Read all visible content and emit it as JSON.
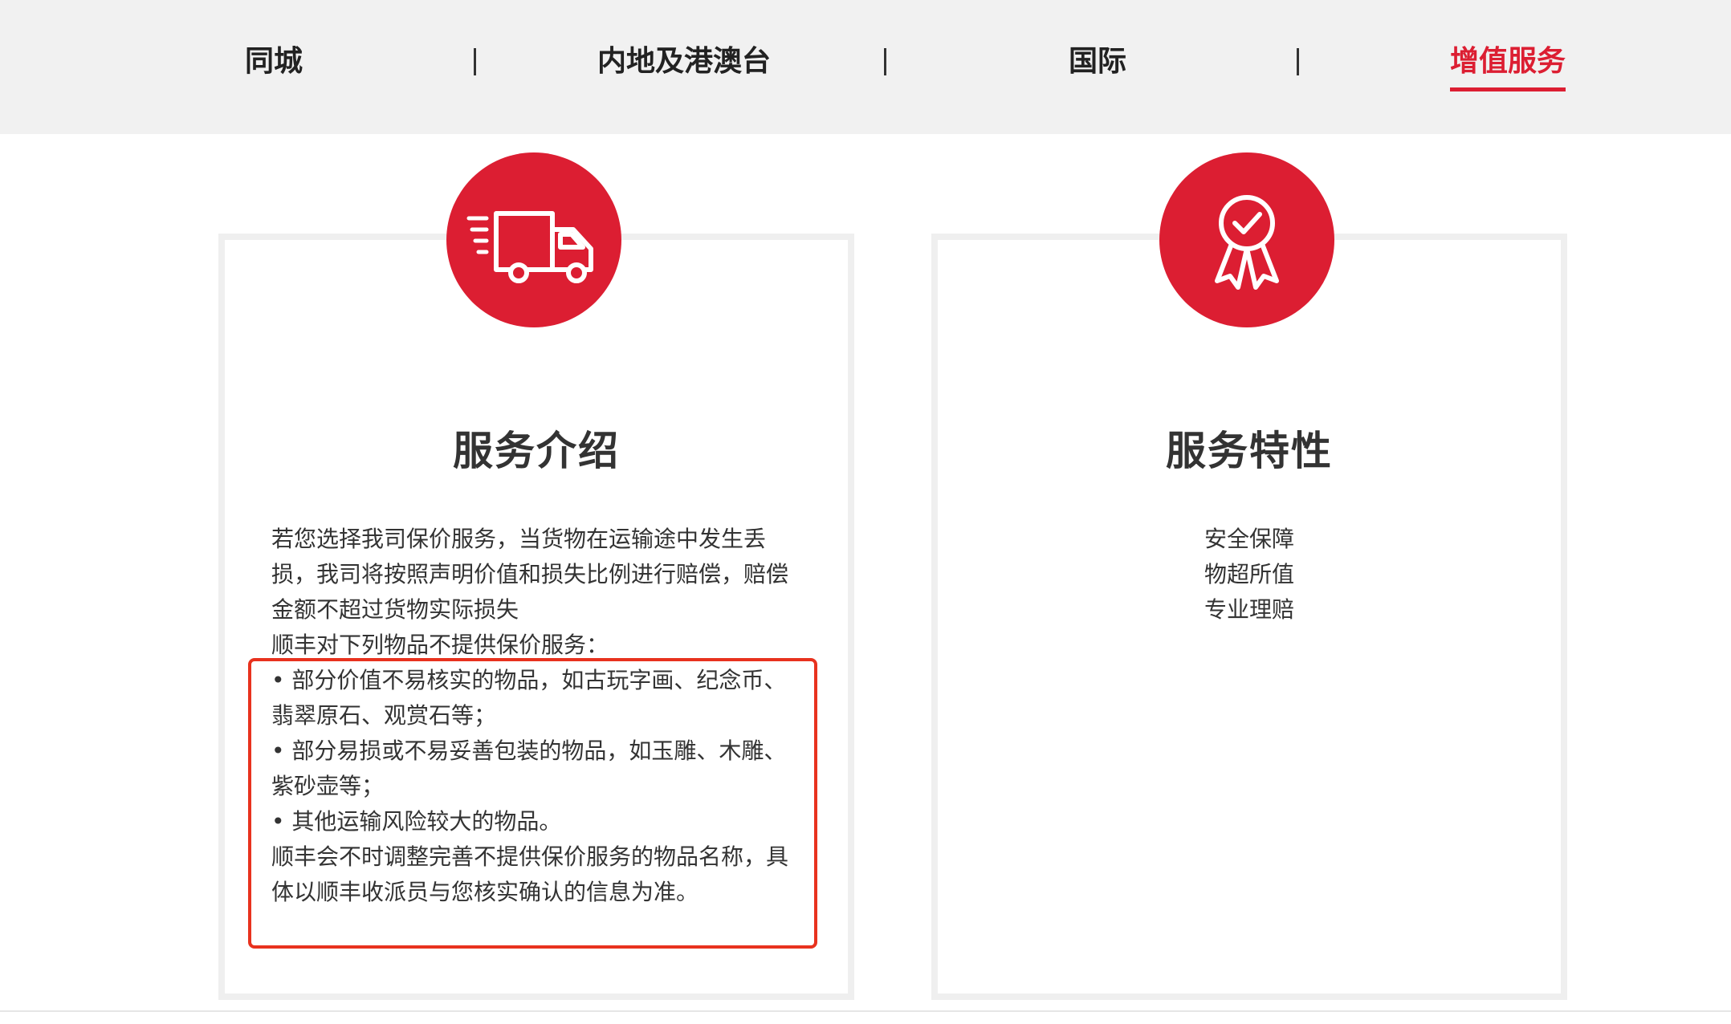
{
  "nav": {
    "tabs": [
      {
        "label": "同城",
        "active": false
      },
      {
        "label": "内地及港澳台",
        "active": false
      },
      {
        "label": "国际",
        "active": false
      },
      {
        "label": "增值服务",
        "active": true
      }
    ]
  },
  "colors": {
    "accent": "#dc1e32",
    "nav_bg": "#f1f1f1",
    "highlight_border": "#e8321e"
  },
  "cards": {
    "intro": {
      "icon": "truck-icon",
      "title": "服务介绍",
      "paragraphs": [
        "若您选择我司保价服务，当货物在运输途中发生丢损，我司将按照声明价值和损失比例进行赔偿，赔偿金额不超过货物实际损失",
        "顺丰对下列物品不提供保价服务：",
        "• 部分价值不易核实的物品，如古玩字画、纪念币、翡翠原石、观赏石等；",
        "• 部分易损或不易妥善包装的物品，如玉雕、木雕、紫砂壶等；",
        "• 其他运输风险较大的物品。",
        "顺丰会不时调整完善不提供保价服务的物品名称，具体以顺丰收派员与您核实确认的信息为准。"
      ]
    },
    "features": {
      "icon": "award-ribbon-icon",
      "title": "服务特性",
      "items": [
        "安全保障",
        "物超所值",
        "专业理赔"
      ]
    }
  }
}
